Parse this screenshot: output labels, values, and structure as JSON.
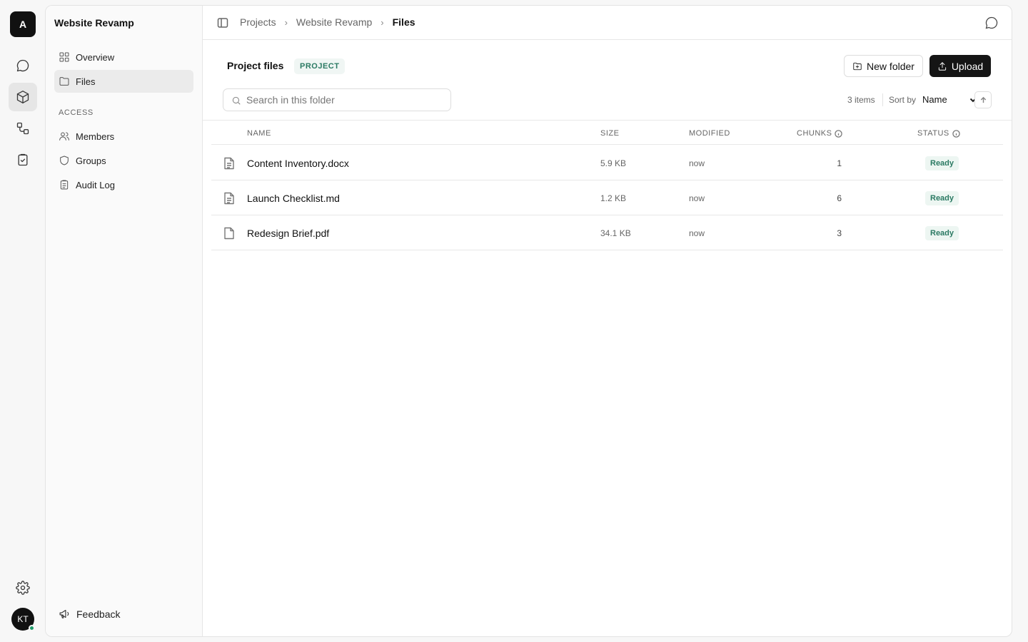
{
  "app": {
    "logo_letter": "A",
    "user_initials": "KT"
  },
  "rail": [
    "chat-icon",
    "package-icon",
    "workflow-icon",
    "clipboard-check-icon"
  ],
  "sidebar": {
    "project_title": "Website Revamp",
    "items": [
      {
        "label": "Overview",
        "icon": "grid-icon"
      },
      {
        "label": "Files",
        "icon": "folder-icon",
        "active": true
      }
    ],
    "access_title": "ACCESS",
    "access_items": [
      {
        "label": "Members",
        "icon": "users-icon"
      },
      {
        "label": "Groups",
        "icon": "shield-icon"
      },
      {
        "label": "Audit Log",
        "icon": "clipboard-icon"
      }
    ],
    "feedback_label": "Feedback"
  },
  "breadcrumb": [
    "Projects",
    "Website Revamp",
    "Files"
  ],
  "header": {
    "title": "Project files",
    "badge": "PROJECT",
    "new_folder_label": "New folder",
    "upload_label": "Upload"
  },
  "search": {
    "placeholder": "Search in this folder",
    "value": ""
  },
  "toolbar": {
    "items_count": "3 items",
    "sort_label": "Sort by",
    "sort_value": "Name"
  },
  "table": {
    "columns": {
      "name": "NAME",
      "size": "SIZE",
      "modified": "MODIFIED",
      "chunks": "CHUNKS",
      "status": "STATUS"
    },
    "rows": [
      {
        "name": "Content Inventory.docx",
        "size": "5.9 KB",
        "modified": "now",
        "chunks": "1",
        "status": "Ready"
      },
      {
        "name": "Launch Checklist.md",
        "size": "1.2 KB",
        "modified": "now",
        "chunks": "6",
        "status": "Ready"
      },
      {
        "name": "Redesign Brief.pdf",
        "size": "34.1 KB",
        "modified": "now",
        "chunks": "3",
        "status": "Ready"
      }
    ]
  },
  "colors": {
    "accent": "#2b7a63",
    "dark": "#151515"
  }
}
